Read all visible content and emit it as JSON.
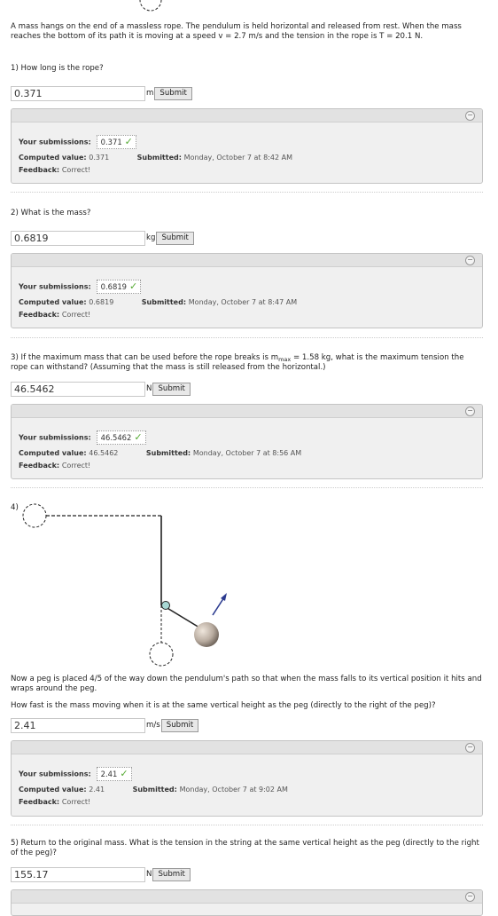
{
  "intro": "A mass hangs on the end of a massless rope. The pendulum is held horizontal and released from rest. When the mass reaches the bottom of its path it is moving at a speed v = 2.7 m/s and the tension in the rope is T = 20.1 N.",
  "labels": {
    "your_submissions": "Your submissions:",
    "computed_value": "Computed value:",
    "feedback": "Feedback:",
    "submitted": "Submitted:",
    "submit": "Submit"
  },
  "q1": {
    "question": "1) How long is the rope?",
    "answer": "0.371",
    "unit": "m",
    "submission": "0.371",
    "computed": "0.371",
    "feedback": "Correct!",
    "submitted_at": "Monday, October 7 at 8:42 AM"
  },
  "q2": {
    "question": "2) What is the mass?",
    "answer": "0.6819",
    "unit": "kg",
    "submission": "0.6819",
    "computed": "0.6819",
    "feedback": "Correct!",
    "submitted_at": "Monday, October 7 at 8:47 AM"
  },
  "q3": {
    "question_pre": "3) If the maximum mass that can be used before the rope breaks is m",
    "question_sub": "max",
    "question_post": " = 1.58 kg, what is the maximum tension the rope can withstand? (Assuming that the mass is still released from the horizontal.)",
    "answer": "46.5462",
    "unit": "N",
    "submission": "46.5462",
    "computed": "46.5462",
    "feedback": "Correct!",
    "submitted_at": "Monday, October 7 at 8:56 AM"
  },
  "q4": {
    "number": "4)",
    "description": "Now a peg is placed 4/5 of the way down the pendulum's path so that when the mass falls to its vertical position it hits and wraps around the peg.",
    "question": "How fast is the mass moving when it is at the same vertical height as the peg (directly to the right of the peg)?",
    "answer": "2.41",
    "unit": "m/s",
    "submission": "2.41",
    "computed": "2.41",
    "feedback": "Correct!",
    "submitted_at": "Monday, October 7 at 9:02 AM"
  },
  "q5": {
    "question": "5) Return to the original mass. What is the tension in the string at the same vertical height as the peg (directly to the right of the peg)?",
    "answer": "155.17",
    "unit": "N"
  },
  "icons": {
    "collapse": "collapse-icon",
    "check": "check-icon"
  },
  "colors": {
    "check": "#55aa33",
    "arrow": "#2b3a8f",
    "peg": "#a8d8d4",
    "mass": "#b9aca0"
  }
}
